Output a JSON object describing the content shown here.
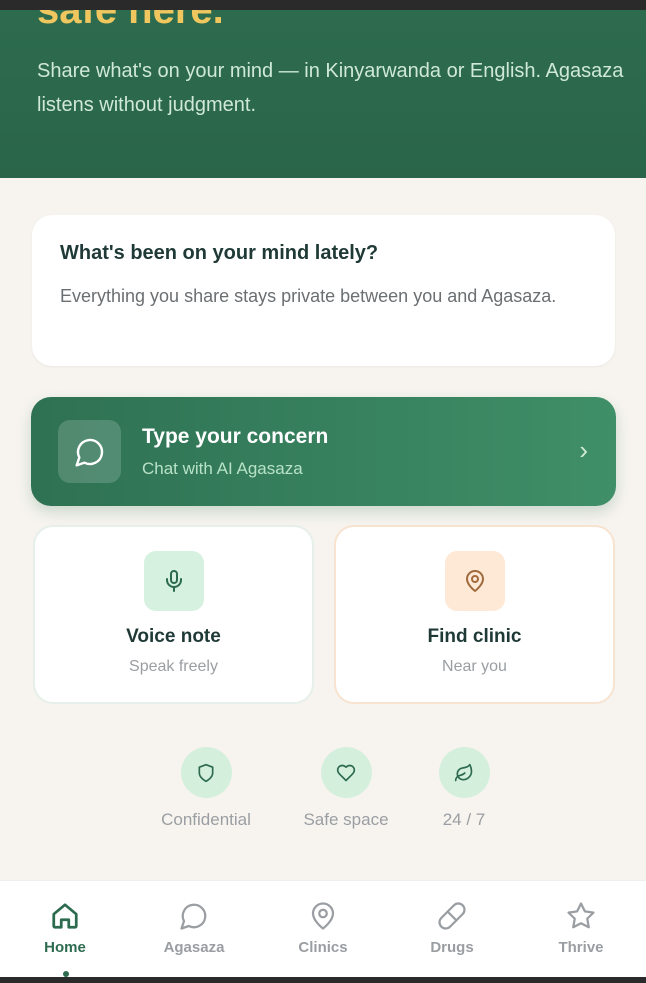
{
  "hero": {
    "title": "safe here.",
    "subtitle": "Share what's on your mind — in Kinyarwanda or English. Agasaza listens without judgment."
  },
  "prompt_card": {
    "heading": "What's been on your mind lately?",
    "body": "Everything you share stays private between you and Agasaza."
  },
  "cta": {
    "title": "Type your concern",
    "subtitle": "Chat with AI Agasaza",
    "icon": "chat-bubble-icon",
    "chevron": "›"
  },
  "tiles": [
    {
      "title": "Voice note",
      "subtitle": "Speak freely",
      "icon": "microphone-icon",
      "accent": "#2d6b4f"
    },
    {
      "title": "Find clinic",
      "subtitle": "Near you",
      "icon": "map-pin-icon",
      "accent": "#a06a3c"
    }
  ],
  "badges": [
    {
      "label": "Confidential",
      "icon": "shield-icon"
    },
    {
      "label": "Safe space",
      "icon": "heart-icon"
    },
    {
      "label": "24 / 7",
      "icon": "leaf-icon"
    }
  ],
  "nav": {
    "active": "Home",
    "items": [
      {
        "label": "Home",
        "icon": "home-icon"
      },
      {
        "label": "Agasaza",
        "icon": "chat-bubble-icon"
      },
      {
        "label": "Clinics",
        "icon": "map-pin-icon"
      },
      {
        "label": "Drugs",
        "icon": "pill-icon"
      },
      {
        "label": "Thrive",
        "icon": "star-icon"
      }
    ]
  },
  "colors": {
    "primary": "#2d6b4f",
    "hero_title": "#f0c75e",
    "background": "#f7f4ef",
    "muted": "#9a9ea2"
  }
}
